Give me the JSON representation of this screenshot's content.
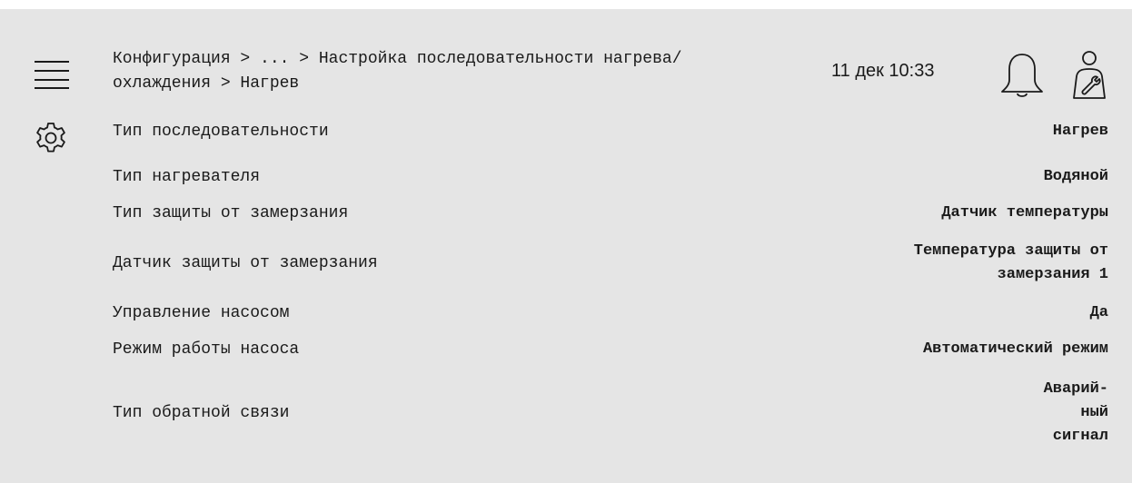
{
  "header": {
    "breadcrumb": "Конфигурация > ... > Настройка последовательности нагрева/охлаждения > Нагрев",
    "datetime": "11 дек 10:33"
  },
  "icons": {
    "menu": "hamburger-menu-icon",
    "settings": "gear-icon",
    "notifications": "bell-icon",
    "user": "service-user-icon"
  },
  "colors": {
    "panel_background": "#e5e5e5",
    "text": "#1a1a1a"
  },
  "settings": [
    {
      "label": "Тип последовательности",
      "value": "Нагрев"
    },
    {
      "label": "Тип нагревателя",
      "value": "Водяной"
    },
    {
      "label": "Тип защиты от замерзания",
      "value": "Датчик температуры"
    },
    {
      "label": "Датчик защиты от замерзания",
      "value": "Температура защиты от\nзамерзания 1"
    },
    {
      "label": "Управление насосом",
      "value": "Да"
    },
    {
      "label": "Режим работы насоса",
      "value": "Автоматический режим"
    },
    {
      "label": "Тип обратной связи",
      "value": "Аварий-\nный\nсигнал"
    }
  ]
}
